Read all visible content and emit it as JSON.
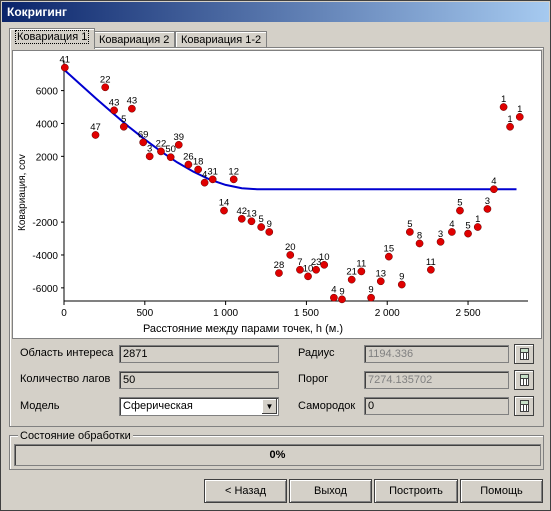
{
  "window": {
    "title": "Кокригинг"
  },
  "tabs": [
    {
      "label": "Ковариация 1",
      "active": true
    },
    {
      "label": "Ковариация 2",
      "active": false
    },
    {
      "label": "Ковариация 1-2",
      "active": false
    }
  ],
  "chart_data": {
    "type": "scatter",
    "title": "",
    "xlabel": "Расстояние между парами точек, h (м.)",
    "ylabel": "Ковариация, cov",
    "xlim": [
      0,
      2871
    ],
    "ylim": [
      -6800,
      7800
    ],
    "xticks": [
      0,
      500,
      1000,
      1500,
      2000,
      2500
    ],
    "xtick_labels": [
      "0",
      "500",
      "1 000",
      "1 500",
      "2 000",
      "2 500"
    ],
    "yticks": [
      -6000,
      -4000,
      -2000,
      2000,
      4000,
      6000
    ],
    "ytick_labels": [
      "-6000",
      "-4000",
      "-2000",
      "2000",
      "4000",
      "6000"
    ],
    "series": [
      {
        "kind": "points",
        "color": "#e00000",
        "points": [
          {
            "x": 5,
            "y": 7400,
            "label": "41"
          },
          {
            "x": 195,
            "y": 3300,
            "label": "47"
          },
          {
            "x": 255,
            "y": 6200,
            "label": "22"
          },
          {
            "x": 310,
            "y": 4800,
            "label": "43"
          },
          {
            "x": 420,
            "y": 4900,
            "label": "43"
          },
          {
            "x": 370,
            "y": 3800,
            "label": "5"
          },
          {
            "x": 490,
            "y": 2850,
            "label": "69"
          },
          {
            "x": 530,
            "y": 2000,
            "label": "3"
          },
          {
            "x": 600,
            "y": 2300,
            "label": "22"
          },
          {
            "x": 660,
            "y": 1950,
            "label": "50"
          },
          {
            "x": 710,
            "y": 2700,
            "label": "39"
          },
          {
            "x": 770,
            "y": 1500,
            "label": "26"
          },
          {
            "x": 830,
            "y": 1200,
            "label": "18"
          },
          {
            "x": 870,
            "y": 400,
            "label": "4"
          },
          {
            "x": 920,
            "y": 600,
            "label": "31"
          },
          {
            "x": 1050,
            "y": 600,
            "label": "12"
          },
          {
            "x": 990,
            "y": -1300,
            "label": "14"
          },
          {
            "x": 1100,
            "y": -1800,
            "label": "42"
          },
          {
            "x": 1160,
            "y": -1950,
            "label": "13"
          },
          {
            "x": 1220,
            "y": -2300,
            "label": "5"
          },
          {
            "x": 1270,
            "y": -2600,
            "label": "9"
          },
          {
            "x": 1330,
            "y": -5100,
            "label": "28"
          },
          {
            "x": 1400,
            "y": -4000,
            "label": "20"
          },
          {
            "x": 1460,
            "y": -4900,
            "label": "7"
          },
          {
            "x": 1510,
            "y": -5300,
            "label": "10"
          },
          {
            "x": 1560,
            "y": -4900,
            "label": "23"
          },
          {
            "x": 1610,
            "y": -4600,
            "label": "10"
          },
          {
            "x": 1670,
            "y": -6600,
            "label": "4"
          },
          {
            "x": 1720,
            "y": -6700,
            "label": "9"
          },
          {
            "x": 1780,
            "y": -5500,
            "label": "21"
          },
          {
            "x": 1840,
            "y": -5000,
            "label": "11"
          },
          {
            "x": 1900,
            "y": -6600,
            "label": "9"
          },
          {
            "x": 1960,
            "y": -5600,
            "label": "13"
          },
          {
            "x": 2010,
            "y": -4100,
            "label": "15"
          },
          {
            "x": 2090,
            "y": -5800,
            "label": "9"
          },
          {
            "x": 2140,
            "y": -2600,
            "label": "5"
          },
          {
            "x": 2200,
            "y": -3300,
            "label": "8"
          },
          {
            "x": 2270,
            "y": -4900,
            "label": "11"
          },
          {
            "x": 2330,
            "y": -3200,
            "label": "3"
          },
          {
            "x": 2400,
            "y": -2600,
            "label": "4"
          },
          {
            "x": 2450,
            "y": -1300,
            "label": "5"
          },
          {
            "x": 2500,
            "y": -2700,
            "label": "5"
          },
          {
            "x": 2560,
            "y": -2300,
            "label": "1"
          },
          {
            "x": 2620,
            "y": -1200,
            "label": "3"
          },
          {
            "x": 2660,
            "y": 0,
            "label": "4"
          },
          {
            "x": 2720,
            "y": 5000,
            "label": "1"
          },
          {
            "x": 2760,
            "y": 3800,
            "label": "1"
          },
          {
            "x": 2820,
            "y": 4400,
            "label": "1"
          }
        ]
      },
      {
        "kind": "model-line",
        "name": "",
        "color": "#0000d0",
        "x": [
          0,
          100,
          200,
          300,
          400,
          500,
          600,
          700,
          800,
          900,
          1000,
          1100,
          1194,
          2800
        ],
        "y": [
          7274,
          6380,
          5500,
          4640,
          3810,
          3030,
          2300,
          1640,
          1070,
          600,
          260,
          60,
          0,
          0
        ]
      }
    ]
  },
  "form": {
    "area_label": "Область интереса",
    "area_value": "2871",
    "lags_label": "Количество лагов",
    "lags_value": "50",
    "model_label": "Модель",
    "model_value": "Сферическая",
    "radius_label": "Радиус",
    "radius_value": "1194.336",
    "sill_label": "Порог",
    "sill_value": "7274.135702",
    "nugget_label": "Самородок",
    "nugget_value": "0"
  },
  "status": {
    "group_label": "Состояние обработки",
    "progress_text": "0%",
    "progress_value": 0
  },
  "buttons": {
    "back": "< Назад",
    "exit": "Выход",
    "build": "Построить",
    "help": "Помощь"
  },
  "icons": [
    "calculator-icon",
    "chevron-down-icon"
  ]
}
